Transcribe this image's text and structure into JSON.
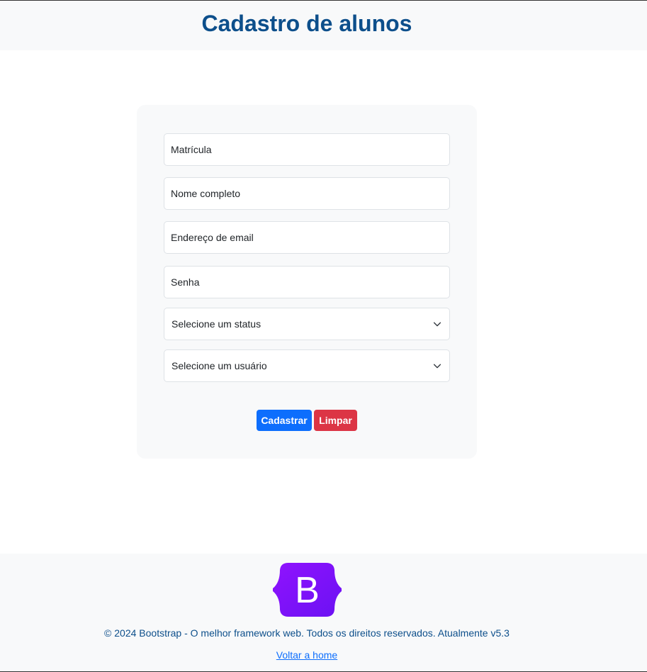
{
  "header": {
    "title": "Cadastro de alunos"
  },
  "form": {
    "matricula_placeholder": "Matrícula",
    "nome_placeholder": "Nome completo",
    "email_placeholder": "Endereço de email",
    "senha_placeholder": "Senha",
    "status_select": "Selecione um status",
    "usuario_select": "Selecione um usuário",
    "submit_label": "Cadastrar",
    "clear_label": "Limpar"
  },
  "footer": {
    "logo_letter": "B",
    "copyright": "© 2024 Bootstrap - O melhor framework web. Todos os direitos reservados. Atualmente v5.3",
    "home_link": "Voltar a home"
  },
  "colors": {
    "title": "#0d4f8b",
    "primary": "#0d6efd",
    "danger": "#dc3545",
    "bootstrap_purple": "#7f0df9"
  }
}
